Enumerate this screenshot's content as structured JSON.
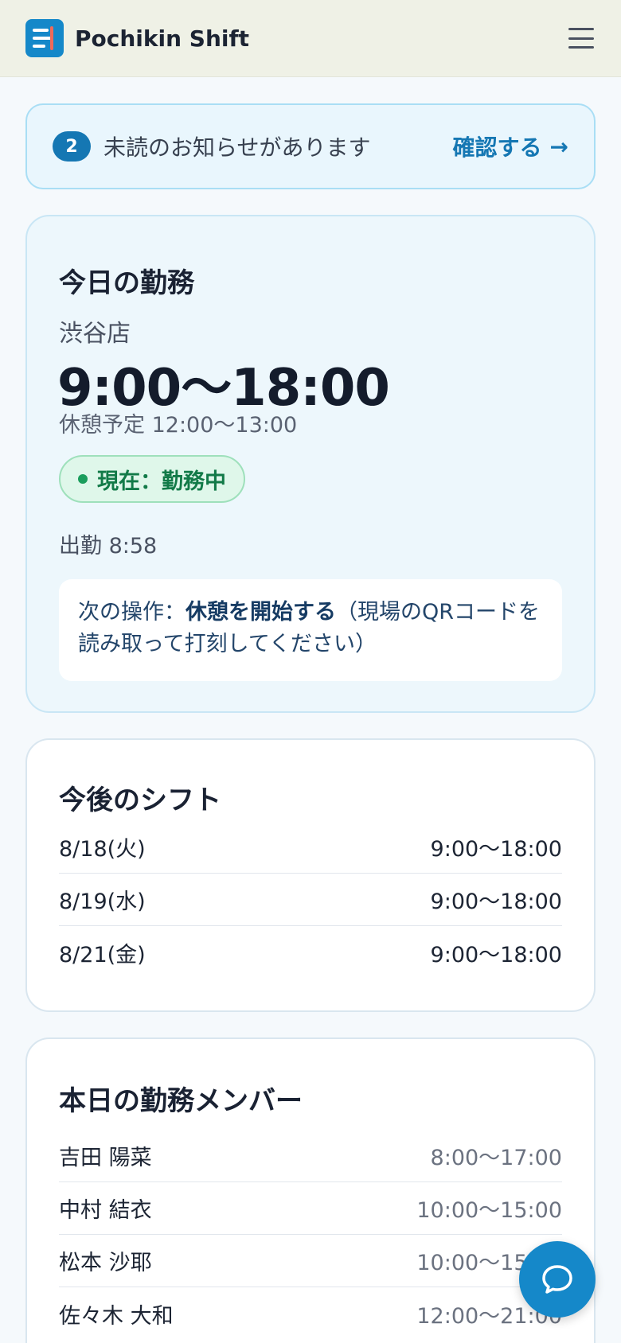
{
  "header": {
    "brand": "Pochikin Shift",
    "logo_icon": "app-logo",
    "menu_icon": "hamburger-menu-icon",
    "bg_color": "#eff1e6"
  },
  "notice": {
    "count": "2",
    "message": "未読のお知らせがあります",
    "link_label": "確認する",
    "arrow": "→",
    "accent": "#1577b3"
  },
  "today": {
    "title": "今日の勤務",
    "store": "渋谷店",
    "time": "9:00〜18:00",
    "break": "休憩予定 12:00〜13:00",
    "status": "現在：勤務中",
    "clock_in": "出勤 8:58",
    "next_prefix": "次の操作：",
    "next_action": "休憩を開始する",
    "next_suffix": "（現場のQRコードを読み取って打刻してください）",
    "status_color": "#127a48"
  },
  "upcoming": {
    "title": "今後のシフト",
    "shifts": [
      {
        "date": "8/18(火)",
        "time": "9:00〜18:00"
      },
      {
        "date": "8/19(水)",
        "time": "9:00〜18:00"
      },
      {
        "date": "8/21(金)",
        "time": "9:00〜18:00"
      }
    ]
  },
  "members": {
    "title": "本日の勤務メンバー",
    "list": [
      {
        "name": "吉田 陽菜",
        "time": "8:00〜17:00"
      },
      {
        "name": "中村 結衣",
        "time": "10:00〜15:00"
      },
      {
        "name": "松本 沙耶",
        "time": "10:00〜15:00"
      },
      {
        "name": "佐々木 大和",
        "time": "12:00〜21:00"
      }
    ]
  },
  "chat": {
    "icon": "chat-bubble-icon",
    "color": "#1588c9"
  }
}
